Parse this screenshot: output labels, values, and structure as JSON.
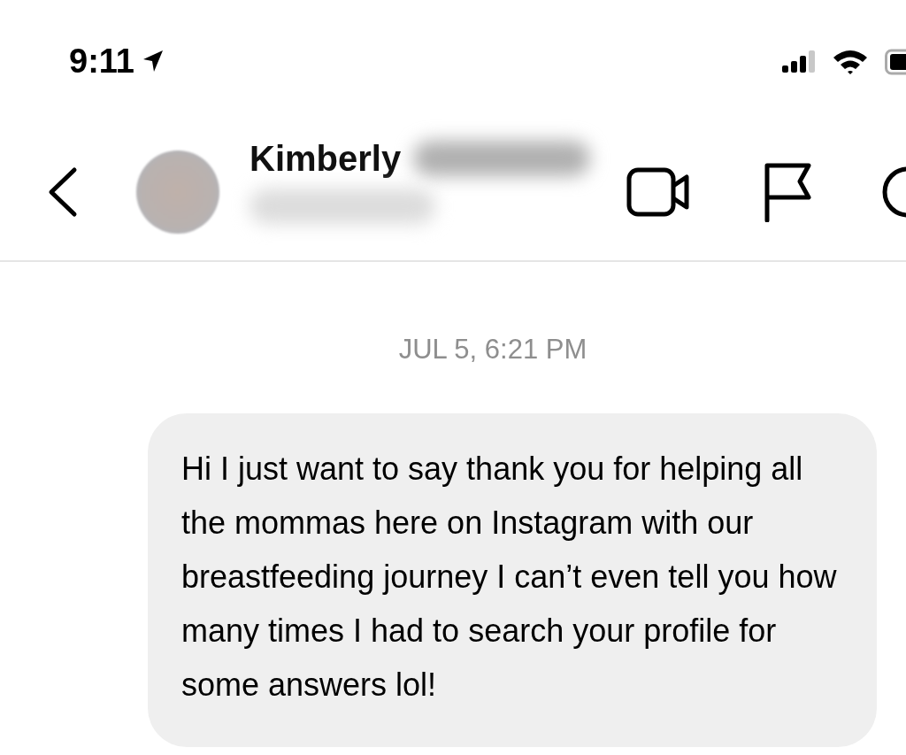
{
  "status_bar": {
    "time": "9:11"
  },
  "header": {
    "name": "Kimberly"
  },
  "thread": {
    "timestamp": "JUL 5, 6:21 PM",
    "messages": [
      {
        "kind": "received",
        "text": "Hi I just want to say thank you for helping all the mommas here on Instagram with our breastfeeding journey I can’t even tell you how many times I had to search your profile for some answers lol!"
      }
    ]
  }
}
